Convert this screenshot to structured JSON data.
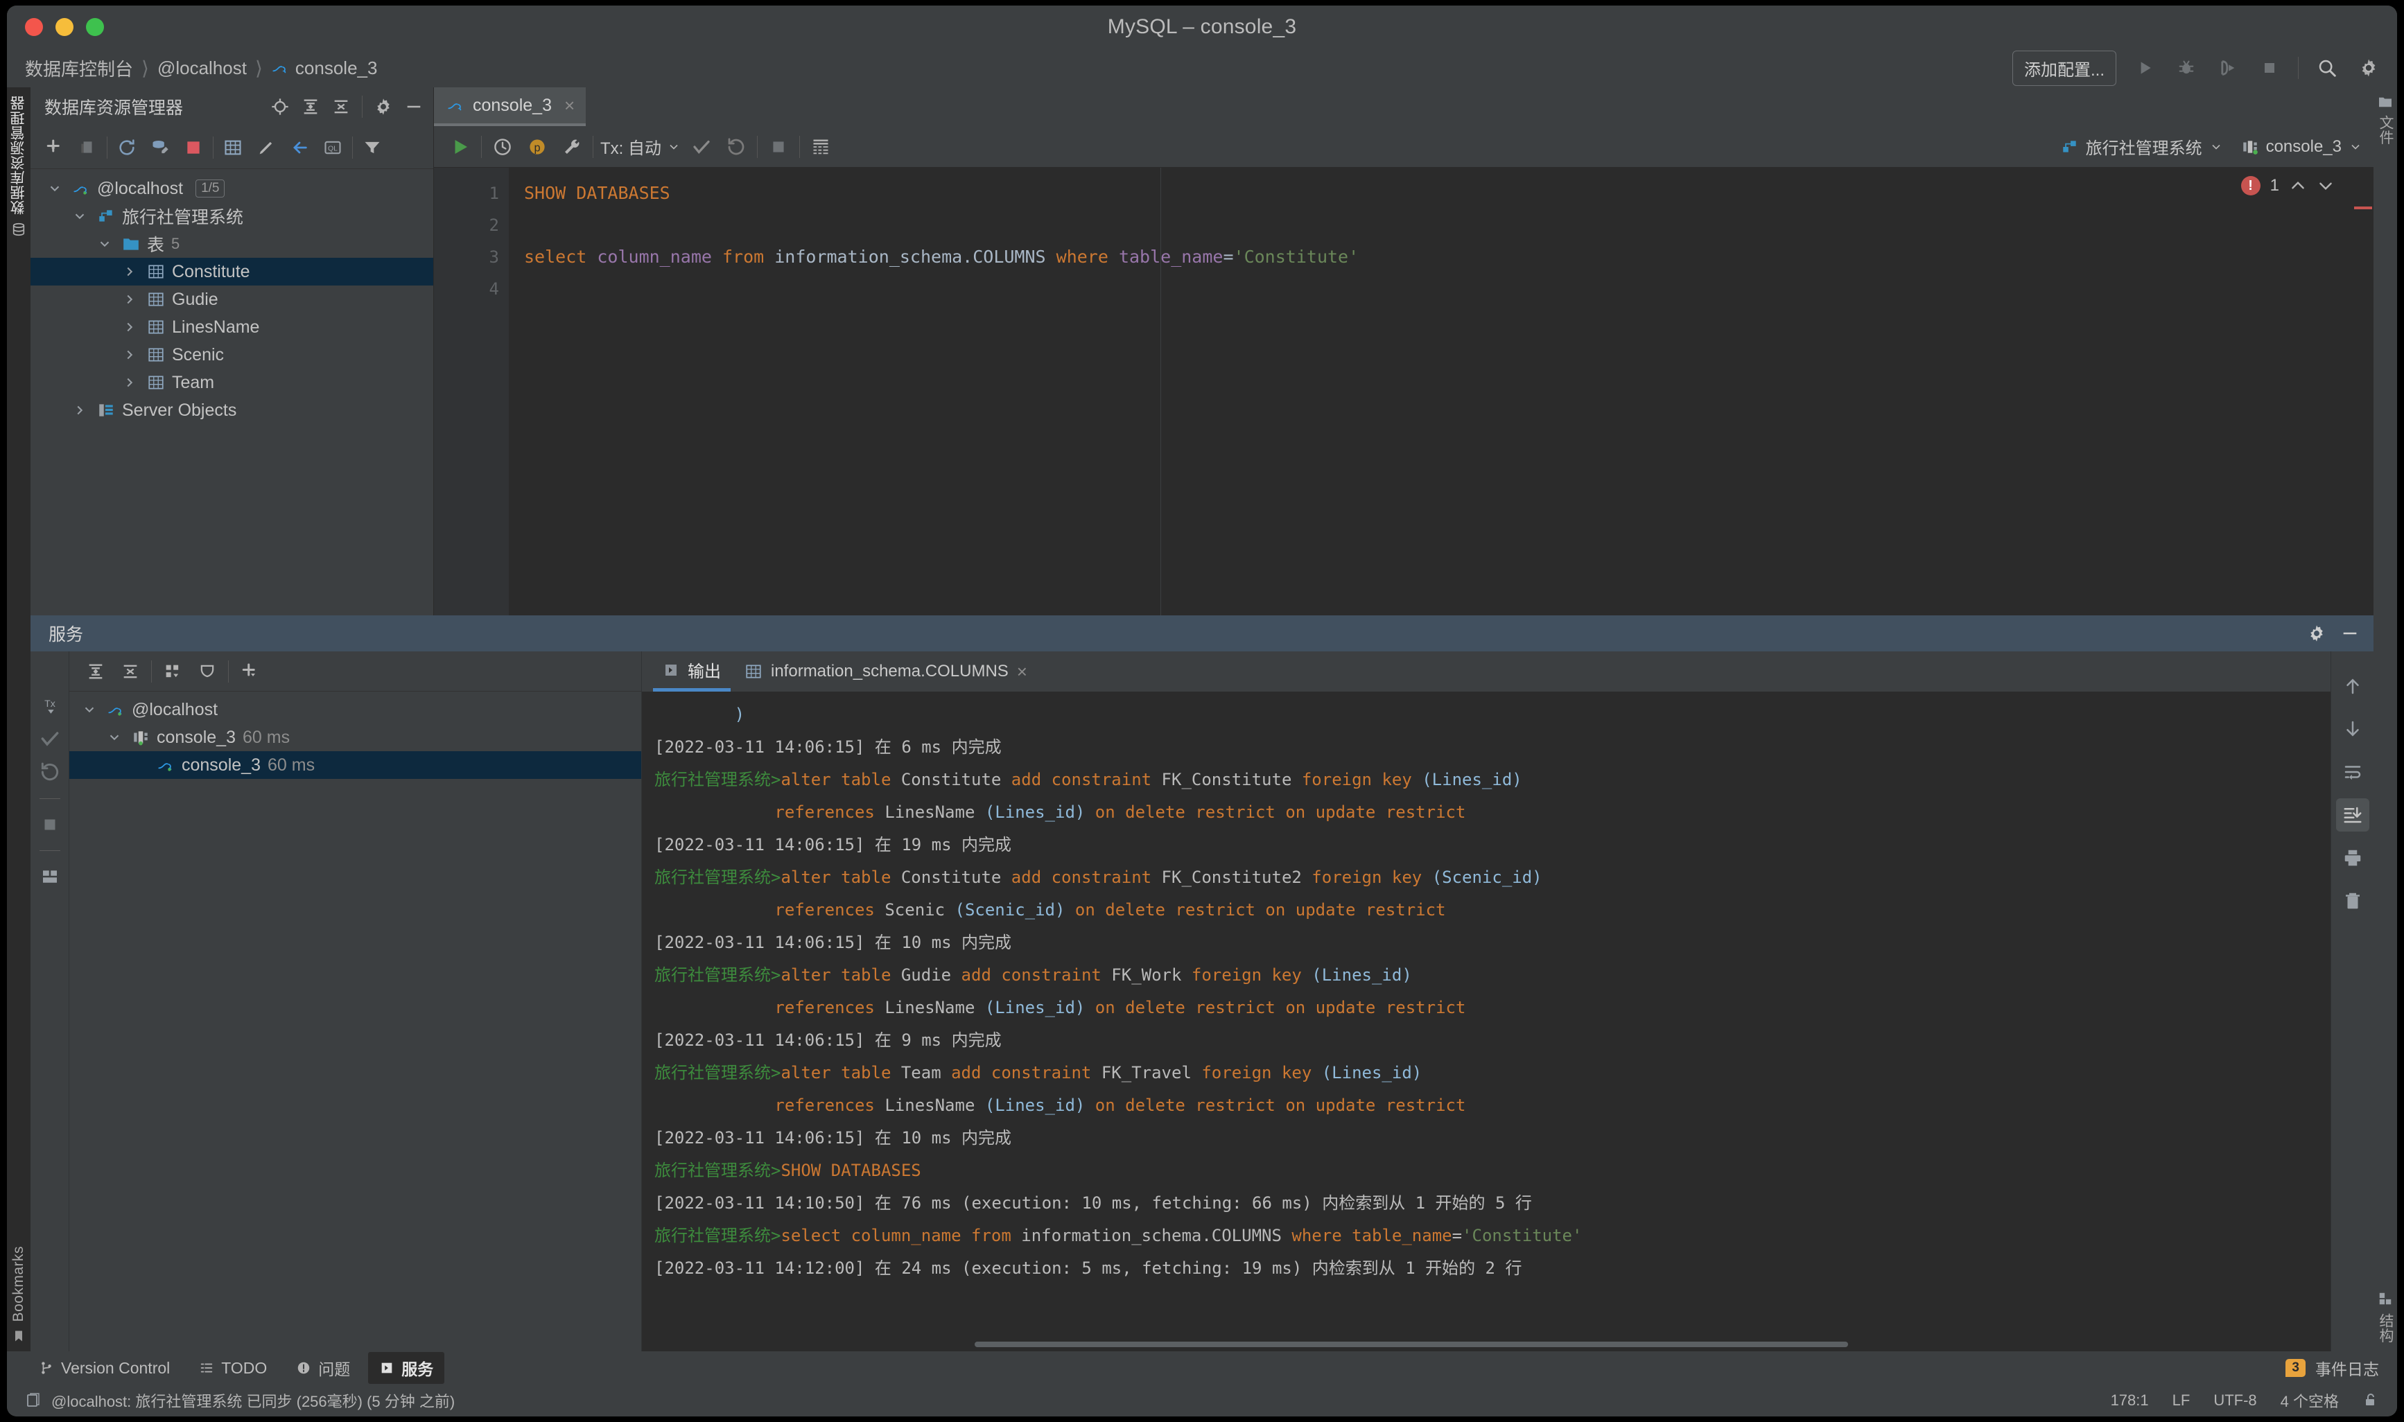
{
  "window": {
    "title": "MySQL – console_3"
  },
  "breadcrumb": {
    "items": [
      "数据库控制台",
      "@localhost",
      "console_3"
    ]
  },
  "navbar": {
    "add_config_label": "添加配置...",
    "icons": [
      "run-icon",
      "debug-icon",
      "run-coverage-icon",
      "stop-icon",
      "search-icon",
      "settings-icon"
    ]
  },
  "rail_left": {
    "top_label": "数据库资源管理器",
    "bottom_label": "Bookmarks"
  },
  "rail_right": {
    "top_label": "文件",
    "bottom_label": "结构"
  },
  "db_explorer": {
    "title": "数据库资源管理器",
    "tools": [
      "add-icon",
      "copy-icon",
      "refresh-icon",
      "sync-icon",
      "stop-icon",
      "table-icon",
      "edit-icon",
      "jump-to-icon",
      "query-console-icon",
      "filter-icon"
    ],
    "header_icons": [
      "locate-icon",
      "expand-all-icon",
      "collapse-all-icon",
      "gear-icon",
      "minimize-icon"
    ],
    "tree": [
      {
        "label": "@localhost",
        "badge": "1/5",
        "icon": "mysql-icon",
        "depth": 0,
        "chevron": "down",
        "selected": false,
        "count": ""
      },
      {
        "label": "旅行社管理系统",
        "badge": "",
        "icon": "schema-icon",
        "depth": 1,
        "chevron": "down",
        "selected": false,
        "count": ""
      },
      {
        "label": "表",
        "badge": "",
        "icon": "folder-icon",
        "depth": 2,
        "chevron": "down",
        "selected": false,
        "count": "5"
      },
      {
        "label": "Constitute",
        "badge": "",
        "icon": "table-icon",
        "depth": 3,
        "chevron": "right",
        "selected": true,
        "count": ""
      },
      {
        "label": "Gudie",
        "badge": "",
        "icon": "table-icon",
        "depth": 3,
        "chevron": "right",
        "selected": false,
        "count": ""
      },
      {
        "label": "LinesName",
        "badge": "",
        "icon": "table-icon",
        "depth": 3,
        "chevron": "right",
        "selected": false,
        "count": ""
      },
      {
        "label": "Scenic",
        "badge": "",
        "icon": "table-icon",
        "depth": 3,
        "chevron": "right",
        "selected": false,
        "count": ""
      },
      {
        "label": "Team",
        "badge": "",
        "icon": "table-icon",
        "depth": 3,
        "chevron": "right",
        "selected": false,
        "count": ""
      },
      {
        "label": "Server Objects",
        "badge": "",
        "icon": "server-icon",
        "depth": 1,
        "chevron": "right",
        "selected": false,
        "count": ""
      }
    ]
  },
  "editor": {
    "tab": {
      "label": "console_3",
      "icon": "mysql-icon",
      "close": "×"
    },
    "toolbar": {
      "run_icon": "run-icon",
      "history_icon": "history-icon",
      "params_icon": "parameters-icon",
      "wrench_icon": "wrench-icon",
      "tx_label": "Tx: 自动",
      "commit_icon": "commit-icon",
      "rollback_icon": "rollback-icon",
      "stop_icon": "stop-icon",
      "grid_icon": "data-grid-icon",
      "schema_chip": "旅行社管理系统",
      "session_chip": "console_3"
    },
    "error_count": "1",
    "lines": [
      {
        "no": "1",
        "marked": false,
        "boxed": false,
        "tokens": [
          {
            "t": "SHOW DATABASES",
            "c": "k"
          }
        ]
      },
      {
        "no": "2",
        "marked": false,
        "boxed": false,
        "tokens": []
      },
      {
        "no": "3",
        "marked": true,
        "boxed": true,
        "tokens": [
          {
            "t": "select ",
            "c": "k"
          },
          {
            "t": "column_name",
            "c": "col"
          },
          {
            "t": " from ",
            "c": "k"
          },
          {
            "t": "information_schema.COLUMNS",
            "c": "id"
          },
          {
            "t": " where ",
            "c": "k"
          },
          {
            "t": "table_name",
            "c": "col"
          },
          {
            "t": "=",
            "c": "op"
          },
          {
            "t": "'Constitute'",
            "c": "str"
          }
        ]
      },
      {
        "no": "4",
        "marked": false,
        "boxed": false,
        "tokens": []
      }
    ]
  },
  "services": {
    "title": "服务",
    "header_icons": [
      "gear-icon",
      "minimize-icon"
    ],
    "rail_icons": [
      "tx-icon",
      "commit-icon",
      "rollback-icon",
      "stop-icon",
      "grid-icon"
    ],
    "tools": [
      "tx-icon",
      "expand-all-icon",
      "collapse-all-icon",
      "group-icon",
      "filter-view-icon",
      "add-icon"
    ],
    "tree": [
      {
        "label": "@localhost",
        "time": "",
        "icon": "mysql-icon",
        "depth": 0,
        "chevron": "down",
        "selected": false
      },
      {
        "label": "console_3",
        "time": "60 ms",
        "icon": "session-icon",
        "depth": 1,
        "chevron": "down",
        "selected": false
      },
      {
        "label": "console_3",
        "time": "60 ms",
        "icon": "mysql-icon",
        "depth": 2,
        "chevron": "",
        "selected": true
      }
    ],
    "console_tabs": [
      {
        "label": "输出",
        "icon": "output-icon",
        "active": true,
        "closable": false
      },
      {
        "label": "information_schema.COLUMNS",
        "icon": "table-icon",
        "active": false,
        "closable": true
      }
    ],
    "log_rail_icons": [
      "scroll-up-icon",
      "scroll-down-icon",
      "soft-wrap-icon",
      "scroll-to-end-icon",
      "print-icon",
      "clear-all-icon"
    ],
    "log": [
      {
        "segs": [
          {
            "t": "        )",
            "c": "lg-p"
          }
        ]
      },
      {
        "segs": [
          {
            "t": "[2022-03-11 14:06:15] 在 6 ms 内完成",
            "c": "lg-t"
          }
        ]
      },
      {
        "segs": [
          {
            "t": "旅行社管理系统>",
            "c": "pfx"
          },
          {
            "t": "alter table ",
            "c": "lg-k"
          },
          {
            "t": "Constitute ",
            "c": "lg-i"
          },
          {
            "t": "add constraint ",
            "c": "lg-k"
          },
          {
            "t": "FK_Constitute ",
            "c": "lg-i"
          },
          {
            "t": "foreign key ",
            "c": "lg-k"
          },
          {
            "t": "(Lines_id)",
            "c": "lg-p"
          }
        ]
      },
      {
        "segs": [
          {
            "t": "            references ",
            "c": "lg-k"
          },
          {
            "t": "LinesName ",
            "c": "lg-i"
          },
          {
            "t": "(Lines_id) ",
            "c": "lg-p"
          },
          {
            "t": "on delete restrict on update restrict",
            "c": "lg-k"
          }
        ]
      },
      {
        "segs": [
          {
            "t": "[2022-03-11 14:06:15] 在 19 ms 内完成",
            "c": "lg-t"
          }
        ]
      },
      {
        "segs": [
          {
            "t": "旅行社管理系统>",
            "c": "pfx"
          },
          {
            "t": "alter table ",
            "c": "lg-k"
          },
          {
            "t": "Constitute ",
            "c": "lg-i"
          },
          {
            "t": "add constraint ",
            "c": "lg-k"
          },
          {
            "t": "FK_Constitute2 ",
            "c": "lg-i"
          },
          {
            "t": "foreign key ",
            "c": "lg-k"
          },
          {
            "t": "(Scenic_id)",
            "c": "lg-p"
          }
        ]
      },
      {
        "segs": [
          {
            "t": "            references ",
            "c": "lg-k"
          },
          {
            "t": "Scenic ",
            "c": "lg-i"
          },
          {
            "t": "(Scenic_id) ",
            "c": "lg-p"
          },
          {
            "t": "on delete restrict on update restrict",
            "c": "lg-k"
          }
        ]
      },
      {
        "segs": [
          {
            "t": "[2022-03-11 14:06:15] 在 10 ms 内完成",
            "c": "lg-t"
          }
        ]
      },
      {
        "segs": [
          {
            "t": "旅行社管理系统>",
            "c": "pfx"
          },
          {
            "t": "alter table ",
            "c": "lg-k"
          },
          {
            "t": "Gudie ",
            "c": "lg-i"
          },
          {
            "t": "add constraint ",
            "c": "lg-k"
          },
          {
            "t": "FK_Work ",
            "c": "lg-i"
          },
          {
            "t": "foreign key ",
            "c": "lg-k"
          },
          {
            "t": "(Lines_id)",
            "c": "lg-p"
          }
        ]
      },
      {
        "segs": [
          {
            "t": "            references ",
            "c": "lg-k"
          },
          {
            "t": "LinesName ",
            "c": "lg-i"
          },
          {
            "t": "(Lines_id) ",
            "c": "lg-p"
          },
          {
            "t": "on delete restrict on update restrict",
            "c": "lg-k"
          }
        ]
      },
      {
        "segs": [
          {
            "t": "[2022-03-11 14:06:15] 在 9 ms 内完成",
            "c": "lg-t"
          }
        ]
      },
      {
        "segs": [
          {
            "t": "旅行社管理系统>",
            "c": "pfx"
          },
          {
            "t": "alter table ",
            "c": "lg-k"
          },
          {
            "t": "Team ",
            "c": "lg-i"
          },
          {
            "t": "add constraint ",
            "c": "lg-k"
          },
          {
            "t": "FK_Travel ",
            "c": "lg-i"
          },
          {
            "t": "foreign key ",
            "c": "lg-k"
          },
          {
            "t": "(Lines_id)",
            "c": "lg-p"
          }
        ]
      },
      {
        "segs": [
          {
            "t": "            references ",
            "c": "lg-k"
          },
          {
            "t": "LinesName ",
            "c": "lg-i"
          },
          {
            "t": "(Lines_id) ",
            "c": "lg-p"
          },
          {
            "t": "on delete restrict on update restrict",
            "c": "lg-k"
          }
        ]
      },
      {
        "segs": [
          {
            "t": "[2022-03-11 14:06:15] 在 10 ms 内完成",
            "c": "lg-t"
          }
        ]
      },
      {
        "segs": [
          {
            "t": "旅行社管理系统>",
            "c": "pfx"
          },
          {
            "t": "SHOW DATABASES",
            "c": "lg-k"
          }
        ]
      },
      {
        "segs": [
          {
            "t": "[2022-03-11 14:10:50] 在 76 ms (execution: 10 ms, fetching: 66 ms) 内检索到从 1 开始的 5 行",
            "c": "lg-t"
          }
        ]
      },
      {
        "segs": [
          {
            "t": "旅行社管理系统>",
            "c": "pfx"
          },
          {
            "t": "select ",
            "c": "lg-k"
          },
          {
            "t": "column_name ",
            "c": "lg-k"
          },
          {
            "t": "from ",
            "c": "lg-k"
          },
          {
            "t": "information_schema.COLUMNS ",
            "c": "lg-i"
          },
          {
            "t": "where ",
            "c": "lg-k"
          },
          {
            "t": "table_name",
            "c": "lg-k"
          },
          {
            "t": "=",
            "c": "lg-i"
          },
          {
            "t": "'Constitute'",
            "c": "lg-s"
          }
        ]
      },
      {
        "segs": [
          {
            "t": "[2022-03-11 14:12:00] 在 24 ms (execution: 5 ms, fetching: 19 ms) 内检索到从 1 开始的 2 行",
            "c": "lg-t"
          }
        ]
      }
    ]
  },
  "toolwindow_bar": {
    "items": [
      {
        "label": "Version Control",
        "icon": "branch-icon",
        "active": false
      },
      {
        "label": "TODO",
        "icon": "todo-icon",
        "active": false
      },
      {
        "label": "问题",
        "icon": "problems-icon",
        "active": false
      },
      {
        "label": "服务",
        "icon": "services-icon",
        "active": true
      }
    ],
    "event_log": {
      "label": "事件日志",
      "badge": "3"
    }
  },
  "statusbar": {
    "message": "@localhost: 旅行社管理系统 已同步 (256毫秒) (5 分钟 之前)",
    "caret": "178:1",
    "line_sep": "LF",
    "encoding": "UTF-8",
    "indent": "4 个空格",
    "lock_icon": "unlocked-icon"
  },
  "colors": {
    "accent_blue": "#4a88c7",
    "keyword_orange": "#cc7832",
    "string_green": "#6a8759",
    "selection_navy": "#0d293e",
    "error_red": "#c75450"
  }
}
